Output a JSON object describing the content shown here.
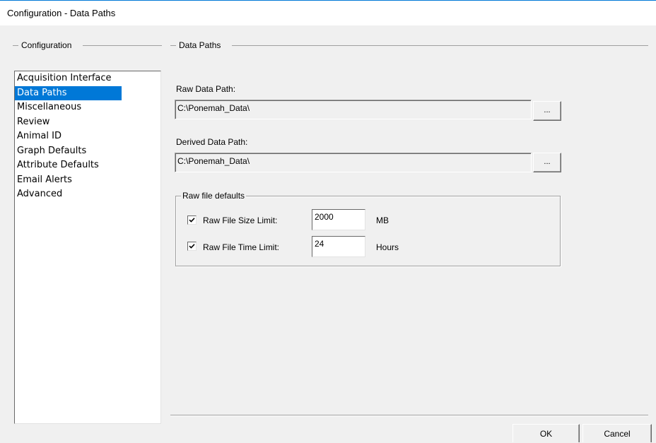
{
  "window": {
    "title": "Configuration - Data Paths"
  },
  "left_group": {
    "label": "Configuration",
    "items": [
      "Acquisition Interface",
      "Data Paths",
      "Miscellaneous",
      "Review",
      "Animal ID",
      "Graph Defaults",
      "Attribute Defaults",
      "Email Alerts",
      "Advanced"
    ],
    "selected": "Data Paths"
  },
  "right_group": {
    "label": "Data Paths",
    "raw_data_path": {
      "label": "Raw Data Path:",
      "value": "C:\\Ponemah_Data\\",
      "browse_label": "..."
    },
    "derived_data_path": {
      "label": "Derived Data Path:",
      "value": "C:\\Ponemah_Data\\",
      "browse_label": "..."
    },
    "raw_file_defaults": {
      "label": "Raw file defaults",
      "size_limit": {
        "label": "Raw File Size Limit:",
        "checked": true,
        "value": "2000",
        "unit": "MB"
      },
      "time_limit": {
        "label": "Raw File Time Limit:",
        "checked": true,
        "value": "24",
        "unit": "Hours"
      }
    }
  },
  "buttons": {
    "ok": "OK",
    "cancel": "Cancel"
  },
  "colors": {
    "selection": "#0078d7",
    "dialog_bg": "#f0f0f0",
    "accent_border": "#0078d7"
  }
}
